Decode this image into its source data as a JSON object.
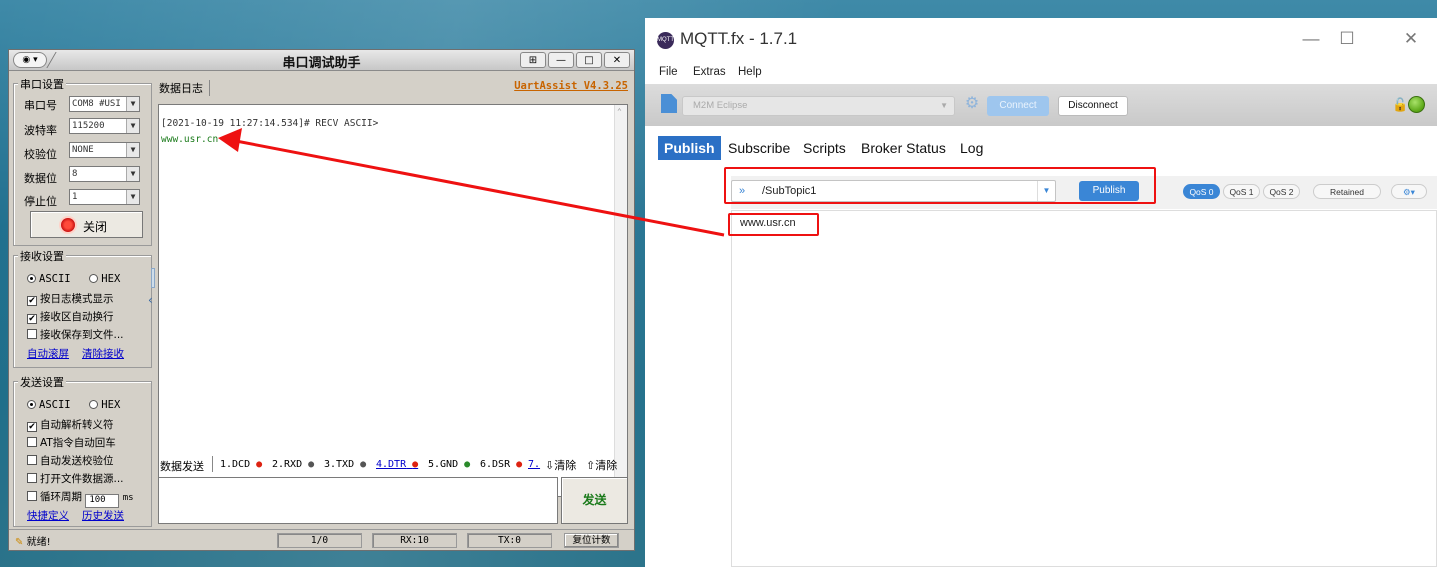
{
  "serial_assistant": {
    "title": "串口调试助手",
    "version": "UartAssist V4.3.25",
    "port_settings": {
      "group_title": "串口设置",
      "port_label": "串口号",
      "port_value": "COM8 #USI",
      "baud_label": "波特率",
      "baud_value": "115200",
      "parity_label": "校验位",
      "parity_value": "NONE",
      "databits_label": "数据位",
      "databits_value": "8",
      "stopbits_label": "停止位",
      "stopbits_value": "1",
      "close_button": "关闭"
    },
    "receive_settings": {
      "group_title": "接收设置",
      "ascii": "ASCII",
      "hex": "HEX",
      "log_mode": "按日志模式显示",
      "auto_newline": "接收区自动换行",
      "save_to_file": "接收保存到文件...",
      "auto_clear": "自动滚屏",
      "clear_receive": "清除接收"
    },
    "send_settings": {
      "group_title": "发送设置",
      "ascii": "ASCII",
      "hex": "HEX",
      "auto_escape": "自动解析转义符",
      "at_auto_cr": "AT指令自动回车",
      "auto_checksum": "自动发送校验位",
      "open_file": "打开文件数据源...",
      "cycle_label": "循环周期",
      "cycle_value": "100",
      "cycle_unit": "ms",
      "quick_define": "快捷定义",
      "history": "历史发送"
    },
    "log": {
      "label": "数据日志",
      "line1": "[2021-10-19 11:27:14.534]# RECV ASCII>",
      "line2": "www.usr.cn"
    },
    "send_bar": {
      "label": "数据发送",
      "dcd": "1.DCD",
      "rxd": "2.RXD",
      "txd": "3.TXD",
      "dtr": "4.DTR",
      "gnd": "5.GND",
      "dsr": "6.DSR",
      "more": "7.",
      "clear1": "清除",
      "clear2": "清除",
      "send_button": "发送"
    },
    "status": {
      "ready": "就绪!",
      "page": "1/0",
      "rx": "RX:10",
      "tx": "TX:0",
      "reset": "复位计数"
    }
  },
  "mqtt": {
    "title": "MQTT.fx - 1.7.1",
    "menu": [
      "File",
      "Extras",
      "Help"
    ],
    "broker": "M2M Eclipse",
    "connect": "Connect",
    "disconnect": "Disconnect",
    "tabs": [
      "Publish",
      "Subscribe",
      "Scripts",
      "Broker Status",
      "Log"
    ],
    "topic": "/SubTopic1",
    "publish_button": "Publish",
    "qos": [
      "QoS 0",
      "QoS 1",
      "QoS 2"
    ],
    "retained": "Retained",
    "payload": "www.usr.cn",
    "colors": {
      "accent": "#2b70c5",
      "annotation": "#e11111",
      "led": "#5aa616"
    }
  }
}
